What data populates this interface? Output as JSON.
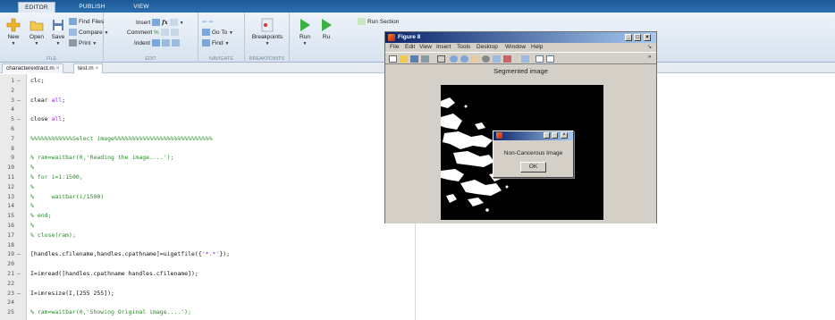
{
  "tabs": [
    {
      "label": "EDITOR"
    },
    {
      "label": "PUBLISH"
    },
    {
      "label": "VIEW"
    }
  ],
  "ribbon": {
    "file": {
      "label": "FILE",
      "new": "New",
      "open": "Open",
      "save": "Save",
      "find_files": "Find Files",
      "compare": "Compare",
      "print": "Print"
    },
    "edit": {
      "label": "EDIT",
      "insert": "Insert",
      "fx": "fx",
      "comment": "Comment",
      "indent": "Indent"
    },
    "navigate": {
      "label": "NAVIGATE",
      "goto": "Go To",
      "find": "Find"
    },
    "breakpoints": {
      "label": "BREAKPOINTS",
      "btn": "Breakpoints"
    },
    "run": {
      "run": "Run",
      "run2": "Ru",
      "run_section": "Run Section"
    }
  },
  "file_tabs": [
    {
      "label": "characterextract.m"
    },
    {
      "label": "test.m"
    }
  ],
  "editor": {
    "lines": [
      {
        "n": "1",
        "bp": "–",
        "segs": [
          {
            "t": "clc;",
            "c": ""
          }
        ]
      },
      {
        "n": "2",
        "bp": "",
        "segs": []
      },
      {
        "n": "3",
        "bp": "–",
        "segs": [
          {
            "t": "clear ",
            "c": ""
          },
          {
            "t": "all",
            "c": "st"
          },
          {
            "t": ";",
            "c": ""
          }
        ]
      },
      {
        "n": "4",
        "bp": "",
        "segs": []
      },
      {
        "n": "5",
        "bp": "–",
        "segs": [
          {
            "t": "close ",
            "c": ""
          },
          {
            "t": "all",
            "c": "st"
          },
          {
            "t": ";",
            "c": ""
          }
        ]
      },
      {
        "n": "6",
        "bp": "",
        "segs": []
      },
      {
        "n": "7",
        "bp": "",
        "segs": [
          {
            "t": "%%%%%%%%%%%%Select image%%%%%%%%%%%%%%%%%%%%%%%%%%%%",
            "c": "cm"
          }
        ]
      },
      {
        "n": "8",
        "bp": "",
        "segs": []
      },
      {
        "n": "9",
        "bp": "",
        "segs": [
          {
            "t": "% ram=waitbar(0,'Reading the image....');",
            "c": "cm"
          }
        ]
      },
      {
        "n": "10",
        "bp": "",
        "segs": [
          {
            "t": "%",
            "c": "cm"
          }
        ]
      },
      {
        "n": "11",
        "bp": "",
        "segs": [
          {
            "t": "% for i=1:1500,",
            "c": "cm"
          }
        ]
      },
      {
        "n": "12",
        "bp": "",
        "segs": [
          {
            "t": "%",
            "c": "cm"
          }
        ]
      },
      {
        "n": "13",
        "bp": "",
        "segs": [
          {
            "t": "%     waitbar(i/1500)",
            "c": "cm"
          }
        ]
      },
      {
        "n": "14",
        "bp": "",
        "segs": [
          {
            "t": "%",
            "c": "cm"
          }
        ]
      },
      {
        "n": "15",
        "bp": "",
        "segs": [
          {
            "t": "% end;",
            "c": "cm"
          }
        ]
      },
      {
        "n": "16",
        "bp": "",
        "segs": [
          {
            "t": "%",
            "c": "cm"
          }
        ]
      },
      {
        "n": "17",
        "bp": "",
        "segs": [
          {
            "t": "% close(ram);",
            "c": "cm"
          }
        ]
      },
      {
        "n": "18",
        "bp": "",
        "segs": []
      },
      {
        "n": "19",
        "bp": "–",
        "segs": [
          {
            "t": "[handles.cfilename,handles.cpathname]=uigetfile({",
            "c": ""
          },
          {
            "t": "'*.*'",
            "c": "st"
          },
          {
            "t": "});",
            "c": ""
          }
        ]
      },
      {
        "n": "20",
        "bp": "",
        "segs": []
      },
      {
        "n": "21",
        "bp": "–",
        "segs": [
          {
            "t": "I=imread([handles.cpathname handles.cfilename]);",
            "c": ""
          }
        ]
      },
      {
        "n": "22",
        "bp": "",
        "segs": []
      },
      {
        "n": "23",
        "bp": "–",
        "segs": [
          {
            "t": "I=imresize(I,[255 255]);",
            "c": ""
          }
        ]
      },
      {
        "n": "24",
        "bp": "",
        "segs": []
      },
      {
        "n": "25",
        "bp": "",
        "segs": [
          {
            "t": "% ram=waitbar(0,'Showing Original image....');",
            "c": "cm"
          }
        ]
      }
    ]
  },
  "figure": {
    "title": "Figure 8",
    "menu": [
      "File",
      "Edit",
      "View",
      "Insert",
      "Tools",
      "Desktop",
      "Window",
      "Help"
    ],
    "heading": "Segmented image",
    "plot_value_fraction_white": 0.3
  },
  "dialog": {
    "message": "Non-Cancerous Image",
    "ok": "OK"
  },
  "colors": {
    "ribbon_top": "#1d5a96",
    "title_bar": "#0a246a"
  }
}
